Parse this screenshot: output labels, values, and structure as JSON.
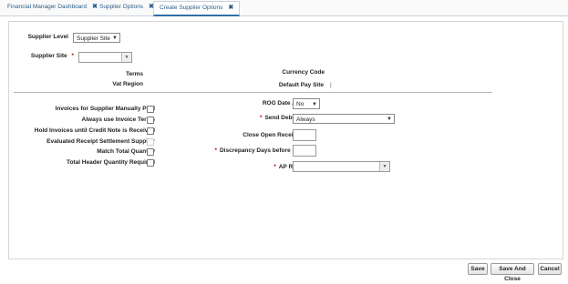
{
  "tabs": [
    {
      "label": "Financial Manager Dashboard",
      "close": "✖"
    },
    {
      "label": "Supplier Options",
      "close": "✖"
    },
    {
      "label": "Create Supplier Options",
      "close": "✖"
    }
  ],
  "form": {
    "supplier_level": {
      "label": "Supplier Level",
      "value": "Supplier Site"
    },
    "supplier_site": {
      "label": "Supplier Site",
      "required_mark": "*",
      "value": ""
    },
    "terms_label": "Terms",
    "vat_region_label": "Vat Region",
    "currency_code_label": "Currency Code",
    "default_pay_site_label": "Default Pay Site",
    "default_pay_site_value": "|"
  },
  "checkboxes": [
    {
      "label": "Invoices for Supplier Manually Paid",
      "checked": false,
      "enabled": true
    },
    {
      "label": "Always use Invoice Terms",
      "checked": false,
      "enabled": true
    },
    {
      "label": "Hold Invoices until Credit Note is Received",
      "checked": false,
      "enabled": true
    },
    {
      "label": "Evaluated Receipt Settlement Supplier",
      "checked": false,
      "enabled": false
    },
    {
      "label": "Match Total Quantity",
      "checked": false,
      "enabled": true
    },
    {
      "label": "Total Header Quantity Required",
      "checked": false,
      "enabled": true
    }
  ],
  "right_fields": {
    "rog_date_allowed": {
      "label": "ROG Date Allowed",
      "value": "No"
    },
    "send_debit_memo": {
      "label": "Send Debit Memo",
      "required_mark": "*",
      "value": "Always"
    },
    "close_open_receipt_days": {
      "label": "Close Open Receipt Days",
      "value": ""
    },
    "discrepancy_days": {
      "label": "Discrepancy Days before Routing",
      "required_mark": "*",
      "value": ""
    },
    "ap_reviewer": {
      "label": "AP Reviewer",
      "required_mark": "*",
      "value": ""
    }
  },
  "buttons": {
    "save": "Save",
    "save_and_close": "Save And Close",
    "cancel": "Cancel"
  }
}
